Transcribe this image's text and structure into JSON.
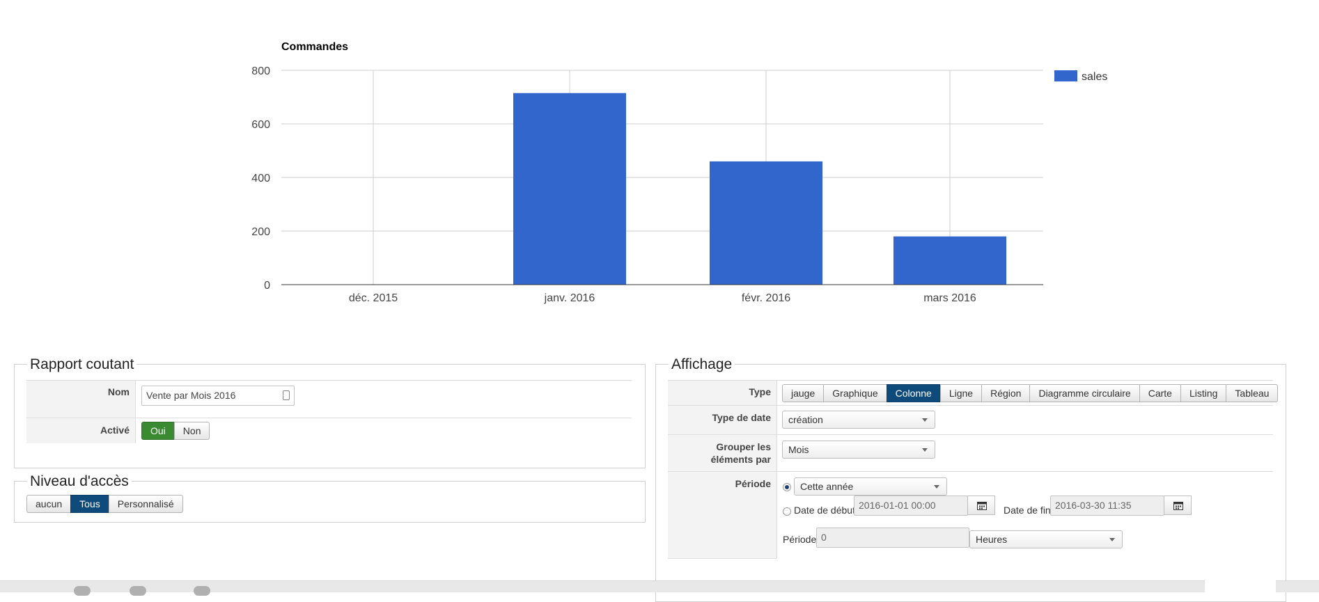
{
  "chart_data": {
    "type": "bar",
    "title": "Commandes",
    "categories": [
      "déc. 2015",
      "janv. 2016",
      "févr. 2016",
      "mars 2016"
    ],
    "series": [
      {
        "name": "sales",
        "values": [
          0,
          715,
          460,
          180
        ],
        "color": "#3366cc"
      }
    ],
    "ylim": [
      0,
      800
    ],
    "yticks": [
      0,
      200,
      400,
      600,
      800
    ],
    "grid": true,
    "legend": "right"
  },
  "rapport": {
    "title": "Rapport coutant",
    "nom_label": "Nom",
    "nom_value": "Vente par Mois 2016",
    "active_label": "Activé",
    "active_options": [
      "Oui",
      "Non"
    ],
    "active_selected": "Oui"
  },
  "acces": {
    "title": "Niveau d'accès",
    "options": [
      "aucun",
      "Tous",
      "Personnalisé"
    ],
    "selected": "Tous"
  },
  "affichage": {
    "title": "Affichage",
    "type_label": "Type",
    "type_options": [
      "jauge",
      "Graphique",
      "Colonne",
      "Ligne",
      "Région",
      "Diagramme circulaire",
      "Carte",
      "Listing",
      "Tableau"
    ],
    "type_selected": "Colonne",
    "date_type_label": "Type de date",
    "date_type_value": "création",
    "group_label": "Grouper les éléments par",
    "group_value": "Mois",
    "periode_label": "Période",
    "periode_select": "Cette année",
    "date_debut_label": "Date de début",
    "date_debut_value": "2016-01-01 00:00",
    "date_fin_label": "Date de fin",
    "date_fin_value": "2016-03-30 11:35",
    "periode2_label": "Période",
    "periode2_value": "0",
    "unit_value": "Heures"
  },
  "colors": {
    "accent_blue": "#0e4a7a",
    "accent_green": "#3a8a31",
    "bar": "#3366cc"
  }
}
